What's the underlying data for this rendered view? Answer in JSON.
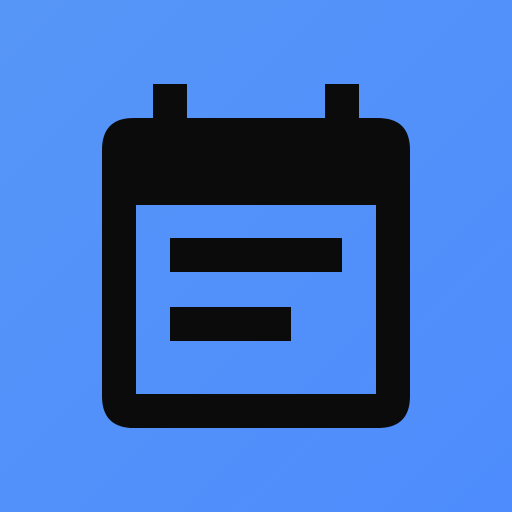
{
  "app_icon": {
    "icon_name": "calendar-notes-icon",
    "colors": {
      "background_start": "#5696f7",
      "background_end": "#4e8cfd",
      "glyph": "#0b0b0b"
    }
  }
}
